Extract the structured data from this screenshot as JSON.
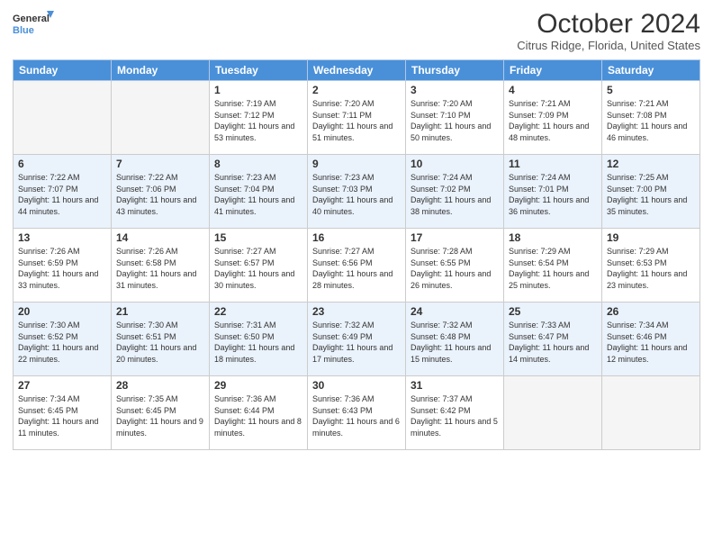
{
  "logo": {
    "text_general": "General",
    "text_blue": "Blue"
  },
  "title": "October 2024",
  "subtitle": "Citrus Ridge, Florida, United States",
  "headers": [
    "Sunday",
    "Monday",
    "Tuesday",
    "Wednesday",
    "Thursday",
    "Friday",
    "Saturday"
  ],
  "weeks": [
    [
      {
        "day": "",
        "sunrise": "",
        "sunset": "",
        "daylight": "",
        "empty": true
      },
      {
        "day": "",
        "sunrise": "",
        "sunset": "",
        "daylight": "",
        "empty": true
      },
      {
        "day": "1",
        "sunrise": "Sunrise: 7:19 AM",
        "sunset": "Sunset: 7:12 PM",
        "daylight": "Daylight: 11 hours and 53 minutes."
      },
      {
        "day": "2",
        "sunrise": "Sunrise: 7:20 AM",
        "sunset": "Sunset: 7:11 PM",
        "daylight": "Daylight: 11 hours and 51 minutes."
      },
      {
        "day": "3",
        "sunrise": "Sunrise: 7:20 AM",
        "sunset": "Sunset: 7:10 PM",
        "daylight": "Daylight: 11 hours and 50 minutes."
      },
      {
        "day": "4",
        "sunrise": "Sunrise: 7:21 AM",
        "sunset": "Sunset: 7:09 PM",
        "daylight": "Daylight: 11 hours and 48 minutes."
      },
      {
        "day": "5",
        "sunrise": "Sunrise: 7:21 AM",
        "sunset": "Sunset: 7:08 PM",
        "daylight": "Daylight: 11 hours and 46 minutes."
      }
    ],
    [
      {
        "day": "6",
        "sunrise": "Sunrise: 7:22 AM",
        "sunset": "Sunset: 7:07 PM",
        "daylight": "Daylight: 11 hours and 44 minutes."
      },
      {
        "day": "7",
        "sunrise": "Sunrise: 7:22 AM",
        "sunset": "Sunset: 7:06 PM",
        "daylight": "Daylight: 11 hours and 43 minutes."
      },
      {
        "day": "8",
        "sunrise": "Sunrise: 7:23 AM",
        "sunset": "Sunset: 7:04 PM",
        "daylight": "Daylight: 11 hours and 41 minutes."
      },
      {
        "day": "9",
        "sunrise": "Sunrise: 7:23 AM",
        "sunset": "Sunset: 7:03 PM",
        "daylight": "Daylight: 11 hours and 40 minutes."
      },
      {
        "day": "10",
        "sunrise": "Sunrise: 7:24 AM",
        "sunset": "Sunset: 7:02 PM",
        "daylight": "Daylight: 11 hours and 38 minutes."
      },
      {
        "day": "11",
        "sunrise": "Sunrise: 7:24 AM",
        "sunset": "Sunset: 7:01 PM",
        "daylight": "Daylight: 11 hours and 36 minutes."
      },
      {
        "day": "12",
        "sunrise": "Sunrise: 7:25 AM",
        "sunset": "Sunset: 7:00 PM",
        "daylight": "Daylight: 11 hours and 35 minutes."
      }
    ],
    [
      {
        "day": "13",
        "sunrise": "Sunrise: 7:26 AM",
        "sunset": "Sunset: 6:59 PM",
        "daylight": "Daylight: 11 hours and 33 minutes."
      },
      {
        "day": "14",
        "sunrise": "Sunrise: 7:26 AM",
        "sunset": "Sunset: 6:58 PM",
        "daylight": "Daylight: 11 hours and 31 minutes."
      },
      {
        "day": "15",
        "sunrise": "Sunrise: 7:27 AM",
        "sunset": "Sunset: 6:57 PM",
        "daylight": "Daylight: 11 hours and 30 minutes."
      },
      {
        "day": "16",
        "sunrise": "Sunrise: 7:27 AM",
        "sunset": "Sunset: 6:56 PM",
        "daylight": "Daylight: 11 hours and 28 minutes."
      },
      {
        "day": "17",
        "sunrise": "Sunrise: 7:28 AM",
        "sunset": "Sunset: 6:55 PM",
        "daylight": "Daylight: 11 hours and 26 minutes."
      },
      {
        "day": "18",
        "sunrise": "Sunrise: 7:29 AM",
        "sunset": "Sunset: 6:54 PM",
        "daylight": "Daylight: 11 hours and 25 minutes."
      },
      {
        "day": "19",
        "sunrise": "Sunrise: 7:29 AM",
        "sunset": "Sunset: 6:53 PM",
        "daylight": "Daylight: 11 hours and 23 minutes."
      }
    ],
    [
      {
        "day": "20",
        "sunrise": "Sunrise: 7:30 AM",
        "sunset": "Sunset: 6:52 PM",
        "daylight": "Daylight: 11 hours and 22 minutes."
      },
      {
        "day": "21",
        "sunrise": "Sunrise: 7:30 AM",
        "sunset": "Sunset: 6:51 PM",
        "daylight": "Daylight: 11 hours and 20 minutes."
      },
      {
        "day": "22",
        "sunrise": "Sunrise: 7:31 AM",
        "sunset": "Sunset: 6:50 PM",
        "daylight": "Daylight: 11 hours and 18 minutes."
      },
      {
        "day": "23",
        "sunrise": "Sunrise: 7:32 AM",
        "sunset": "Sunset: 6:49 PM",
        "daylight": "Daylight: 11 hours and 17 minutes."
      },
      {
        "day": "24",
        "sunrise": "Sunrise: 7:32 AM",
        "sunset": "Sunset: 6:48 PM",
        "daylight": "Daylight: 11 hours and 15 minutes."
      },
      {
        "day": "25",
        "sunrise": "Sunrise: 7:33 AM",
        "sunset": "Sunset: 6:47 PM",
        "daylight": "Daylight: 11 hours and 14 minutes."
      },
      {
        "day": "26",
        "sunrise": "Sunrise: 7:34 AM",
        "sunset": "Sunset: 6:46 PM",
        "daylight": "Daylight: 11 hours and 12 minutes."
      }
    ],
    [
      {
        "day": "27",
        "sunrise": "Sunrise: 7:34 AM",
        "sunset": "Sunset: 6:45 PM",
        "daylight": "Daylight: 11 hours and 11 minutes."
      },
      {
        "day": "28",
        "sunrise": "Sunrise: 7:35 AM",
        "sunset": "Sunset: 6:45 PM",
        "daylight": "Daylight: 11 hours and 9 minutes."
      },
      {
        "day": "29",
        "sunrise": "Sunrise: 7:36 AM",
        "sunset": "Sunset: 6:44 PM",
        "daylight": "Daylight: 11 hours and 8 minutes."
      },
      {
        "day": "30",
        "sunrise": "Sunrise: 7:36 AM",
        "sunset": "Sunset: 6:43 PM",
        "daylight": "Daylight: 11 hours and 6 minutes."
      },
      {
        "day": "31",
        "sunrise": "Sunrise: 7:37 AM",
        "sunset": "Sunset: 6:42 PM",
        "daylight": "Daylight: 11 hours and 5 minutes."
      },
      {
        "day": "",
        "sunrise": "",
        "sunset": "",
        "daylight": "",
        "empty": true
      },
      {
        "day": "",
        "sunrise": "",
        "sunset": "",
        "daylight": "",
        "empty": true
      }
    ]
  ]
}
